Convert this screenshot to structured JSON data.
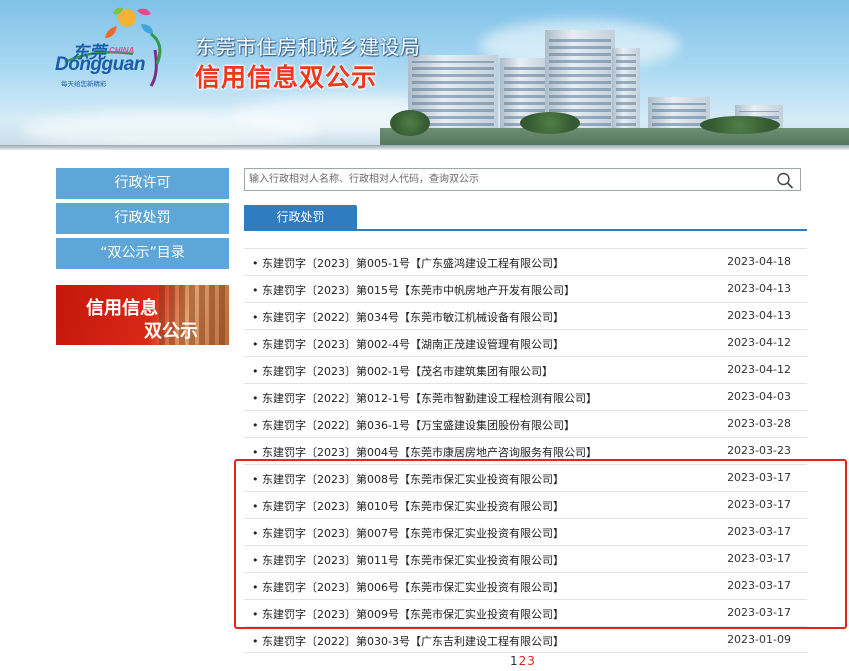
{
  "header": {
    "logo": {
      "cn": "东莞",
      "china": "CHINA",
      "en": "Dongguan",
      "slogan": "每天给您新精彩"
    },
    "title": "东莞市住房和城乡建设局",
    "subtitle": "信用信息双公示"
  },
  "sidebar": {
    "items": [
      {
        "label": "行政许可"
      },
      {
        "label": "行政处罚"
      },
      {
        "label": "“双公示”目录"
      }
    ],
    "promo": {
      "line1": "信用信息",
      "line2": "双公示"
    }
  },
  "search": {
    "placeholder": "输入行政相对人名称、行政相对人代码，查询双公示",
    "icon": "search-icon"
  },
  "tab": {
    "label": "行政处罚"
  },
  "records": [
    {
      "title": "• 东建罚字〔2023〕第005-1号【广东盛鸿建设工程有限公司】",
      "date": "2023-04-18"
    },
    {
      "title": "• 东建罚字〔2023〕第015号【东莞市中帆房地产开发有限公司】",
      "date": "2023-04-13"
    },
    {
      "title": "• 东建罚字〔2022〕第034号【东莞市敏江机械设备有限公司】",
      "date": "2023-04-13"
    },
    {
      "title": "• 东建罚字〔2023〕第002-4号【湖南正茂建设管理有限公司】",
      "date": "2023-04-12"
    },
    {
      "title": "• 东建罚字〔2023〕第002-1号【茂名市建筑集团有限公司】",
      "date": "2023-04-12"
    },
    {
      "title": "• 东建罚字〔2022〕第012-1号【东莞市智勤建设工程检测有限公司】",
      "date": "2023-04-03"
    },
    {
      "title": "• 东建罚字〔2022〕第036-1号【万宝盛建设集团股份有限公司】",
      "date": "2023-03-28"
    },
    {
      "title": "• 东建罚字〔2023〕第004号【东莞市康居房地产咨询服务有限公司】",
      "date": "2023-03-23"
    },
    {
      "title": "• 东建罚字〔2023〕第008号【东莞市保汇实业投资有限公司】",
      "date": "2023-03-17"
    },
    {
      "title": "• 东建罚字〔2023〕第010号【东莞市保汇实业投资有限公司】",
      "date": "2023-03-17"
    },
    {
      "title": "• 东建罚字〔2023〕第007号【东莞市保汇实业投资有限公司】",
      "date": "2023-03-17"
    },
    {
      "title": "• 东建罚字〔2023〕第011号【东莞市保汇实业投资有限公司】",
      "date": "2023-03-17"
    },
    {
      "title": "• 东建罚字〔2023〕第006号【东莞市保汇实业投资有限公司】",
      "date": "2023-03-17"
    },
    {
      "title": "• 东建罚字〔2023〕第009号【东莞市保汇实业投资有限公司】",
      "date": "2023-03-17"
    },
    {
      "title": "• 东建罚字〔2022〕第030-3号【广东吉利建设工程有限公司】",
      "date": "2023-01-09"
    }
  ],
  "pagination": {
    "pages": [
      "1",
      "2",
      "3"
    ],
    "current": "1"
  },
  "colors": {
    "nav": "#5ea6d7",
    "tab": "#2f7cc0",
    "highlight": "#e0251f",
    "subtitle": "#f0371f"
  }
}
